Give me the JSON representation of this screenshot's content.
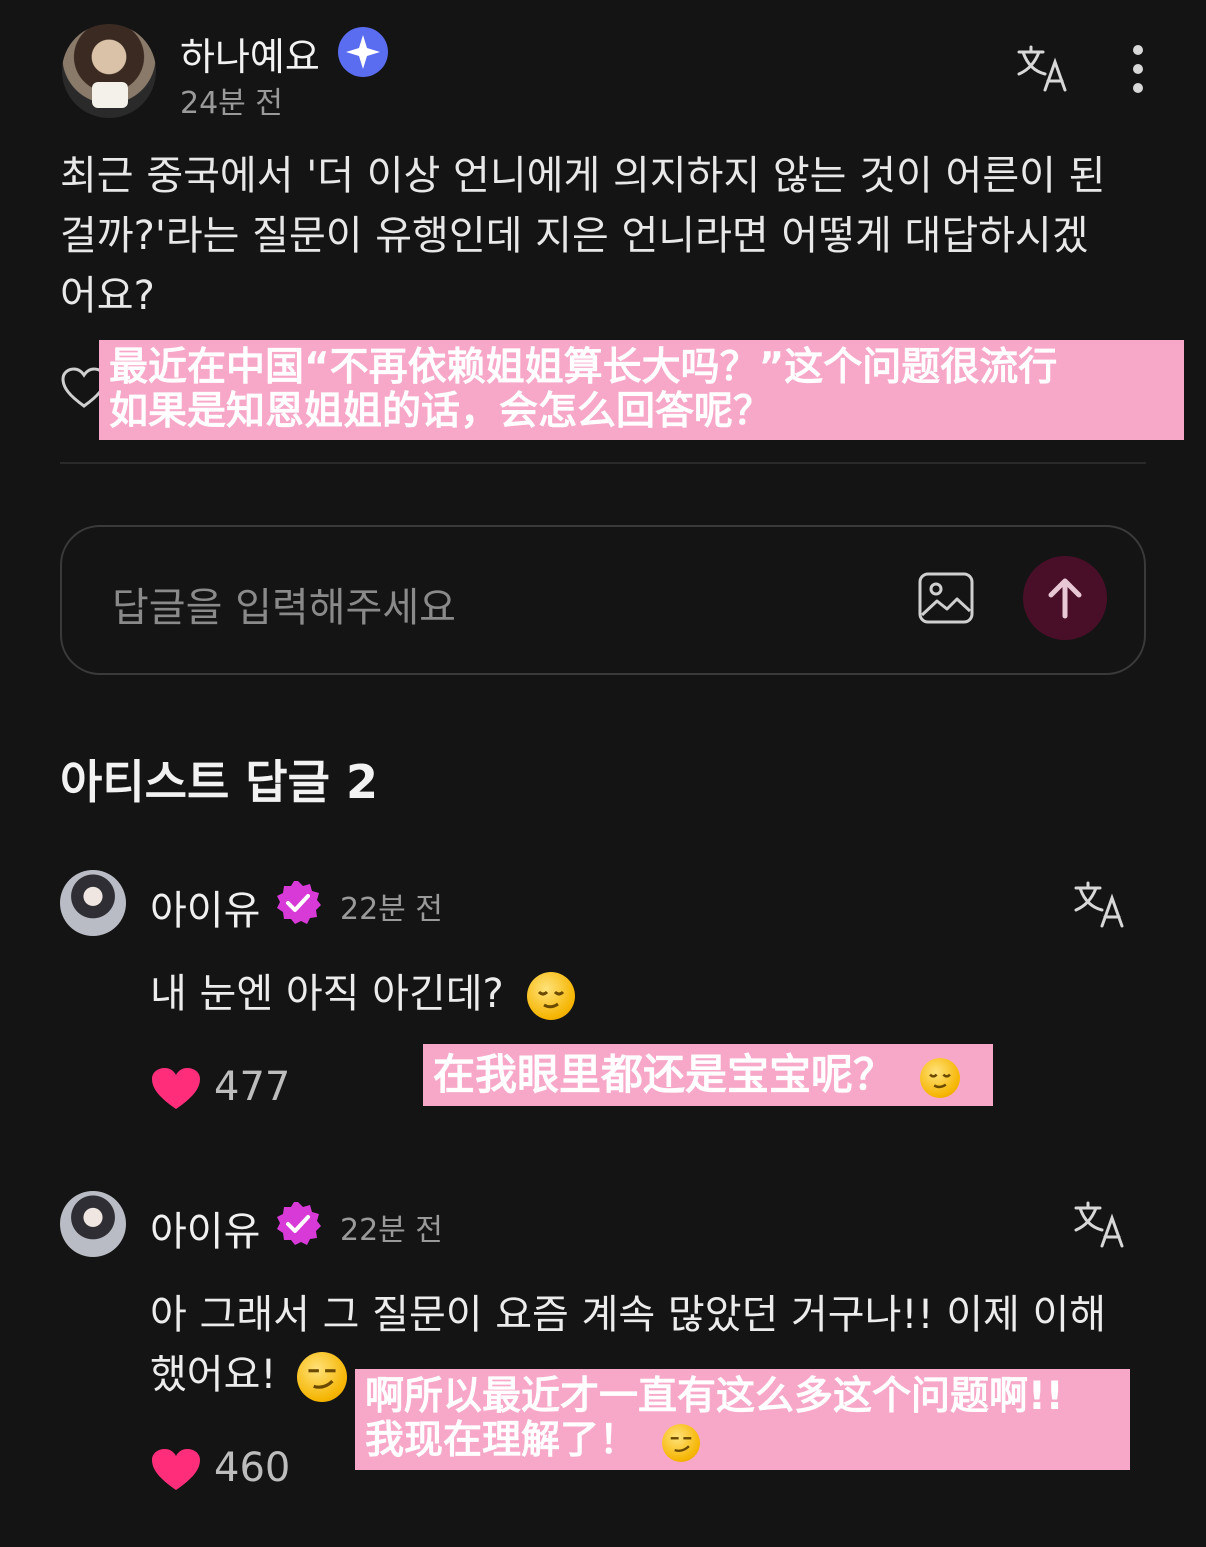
{
  "post": {
    "author": "하나예요",
    "time": "24분 전",
    "body": "최근 중국에서 '더 이상 언니에게 의지하지 않는 것이 어른이 된 걸까?'라는 질문이 유행인데 지은 언니라면 어떻게 대답하시겠어요?",
    "body_lines": [
      "최근 중국에서 '더 이상 언니에게 의지하지 않는 것이 어른이 된",
      "걸까?'라는 질문이 유행인데 지은 언니라면 어떻게 대답하시겠",
      "어요?"
    ],
    "translation_overlay": [
      "最近在中国“不再依赖姐姐算长大吗？”这个问题很流行",
      "如果是知恩姐姐的话，会怎么回答呢？"
    ]
  },
  "reply_box": {
    "placeholder": "답글을 입력해주세요"
  },
  "section": {
    "title": "아티스트 답글 2"
  },
  "comments": [
    {
      "author": "아이유",
      "time": "22분 전",
      "text": "내 눈엔 아직 아긴데?",
      "likes": "477",
      "translation": "在我眼里都还是宝宝呢？"
    },
    {
      "author": "아이유",
      "time": "22분 전",
      "text_lines": [
        "아 그래서 그 질문이 요즘 계속 많았던 거구나!! 이제 이해",
        "했어요!"
      ],
      "likes": "460",
      "translation_lines": [
        "啊所以最近才一直有这么多这个问题啊!!",
        "我现在理解了！"
      ]
    }
  ],
  "colors": {
    "background": "#141414",
    "accent_send": "#4a0f28",
    "verified_post": "#5a6cf0",
    "verified_artist": "#d83ad8",
    "heart": "#ff2d7a",
    "overlay": "#f7a8c8"
  },
  "icons": [
    "translate-icon",
    "more-vertical-icon",
    "heart-outline-icon",
    "image-icon",
    "arrow-up-icon",
    "heart-filled-icon",
    "verified-badge-icon"
  ]
}
